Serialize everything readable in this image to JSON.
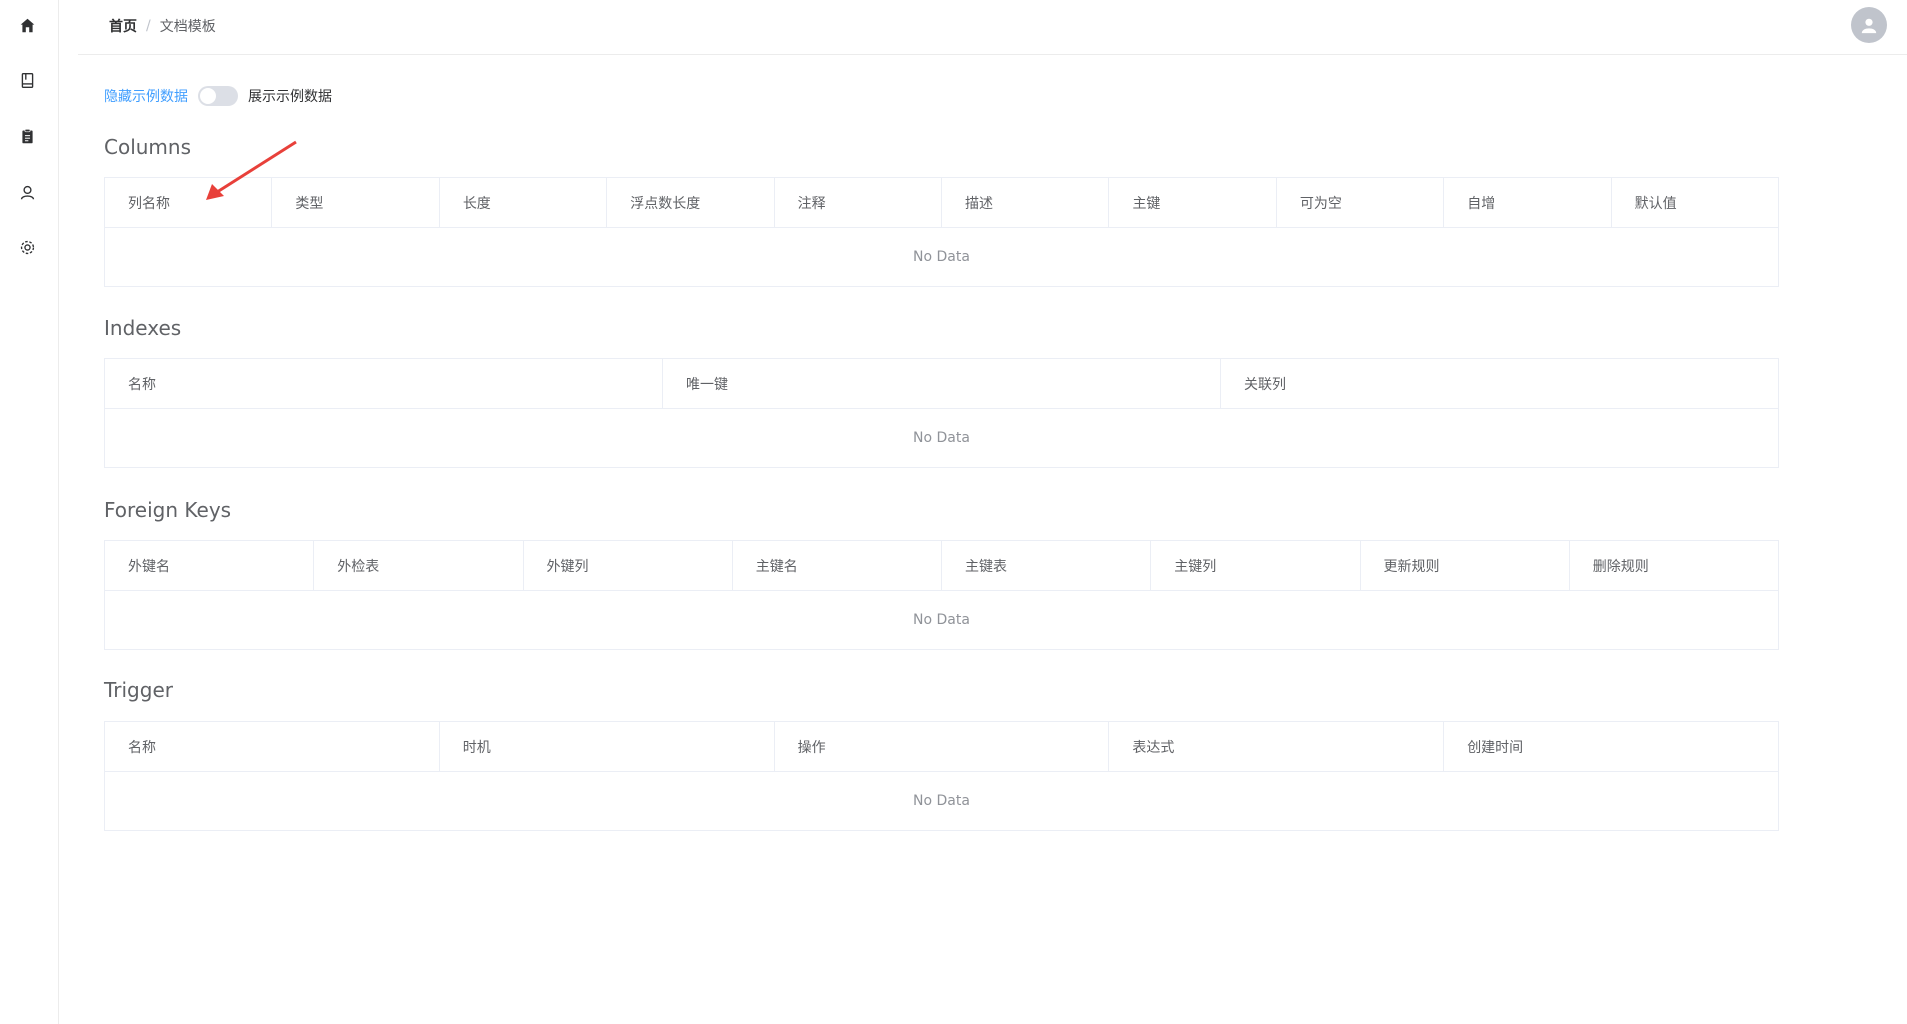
{
  "sidebar": {
    "icons": [
      "home-icon",
      "book-icon",
      "clipboard-icon",
      "user-icon",
      "gear-icon"
    ]
  },
  "breadcrumb": {
    "home": "首页",
    "separator": "/",
    "current": "文档模板"
  },
  "toggle": {
    "left_label": "隐藏示例数据",
    "right_label": "展示示例数据",
    "on": false
  },
  "sections": {
    "columns": {
      "title": "Columns",
      "headers": [
        "列名称",
        "类型",
        "长度",
        "浮点数长度",
        "注释",
        "描述",
        "主键",
        "可为空",
        "自增",
        "默认值"
      ],
      "empty_text": "No Data"
    },
    "indexes": {
      "title": "Indexes",
      "headers": [
        "名称",
        "唯一键",
        "关联列"
      ],
      "empty_text": "No Data"
    },
    "foreign_keys": {
      "title": "Foreign Keys",
      "headers": [
        "外键名",
        "外检表",
        "外键列",
        "主键名",
        "主键表",
        "主键列",
        "更新规则",
        "删除规则"
      ],
      "empty_text": "No Data"
    },
    "trigger": {
      "title": "Trigger",
      "headers": [
        "名称",
        "时机",
        "操作",
        "表达式",
        "创建时间"
      ],
      "empty_text": "No Data"
    }
  },
  "colors": {
    "accent": "#409eff",
    "annotation_arrow": "#e8403a"
  }
}
